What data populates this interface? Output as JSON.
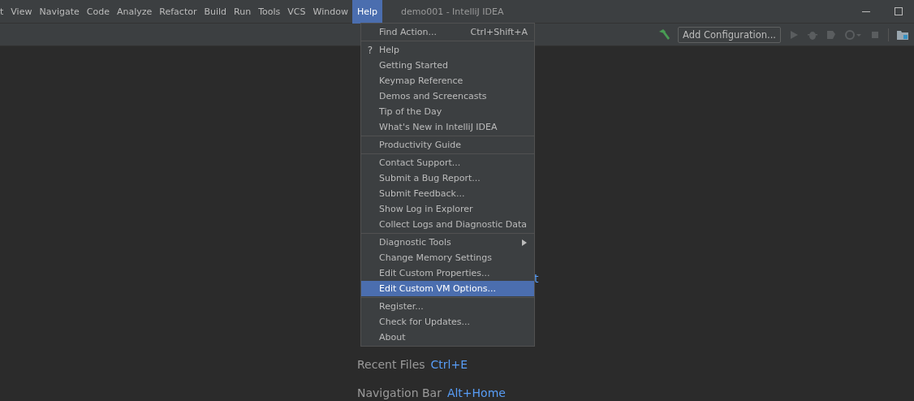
{
  "menu_bar": {
    "items": [
      {
        "label": "t",
        "selected": false
      },
      {
        "label": "View",
        "selected": false
      },
      {
        "label": "Navigate",
        "selected": false
      },
      {
        "label": "Code",
        "selected": false
      },
      {
        "label": "Analyze",
        "selected": false
      },
      {
        "label": "Refactor",
        "selected": false
      },
      {
        "label": "Build",
        "selected": false
      },
      {
        "label": "Run",
        "selected": false
      },
      {
        "label": "Tools",
        "selected": false
      },
      {
        "label": "VCS",
        "selected": false
      },
      {
        "label": "Window",
        "selected": false
      },
      {
        "label": "Help",
        "selected": true
      }
    ]
  },
  "window": {
    "title": "demo001 - IntelliJ IDEA"
  },
  "toolbar": {
    "run_config": "Add Configuration..."
  },
  "help_menu": {
    "groups": [
      [
        {
          "label": "Find Action...",
          "shortcut": "Ctrl+Shift+A",
          "selected": false
        }
      ],
      [
        {
          "glyph": "?",
          "label": "Help",
          "selected": false
        },
        {
          "label": "Getting Started",
          "selected": false
        },
        {
          "label": "Keymap Reference",
          "selected": false
        },
        {
          "label": "Demos and Screencasts",
          "selected": false
        },
        {
          "label": "Tip of the Day",
          "selected": false
        },
        {
          "label": "What's New in IntelliJ IDEA",
          "selected": false
        }
      ],
      [
        {
          "label": "Productivity Guide",
          "selected": false
        }
      ],
      [
        {
          "label": "Contact Support...",
          "selected": false
        },
        {
          "label": "Submit a Bug Report...",
          "selected": false
        },
        {
          "label": "Submit Feedback...",
          "selected": false
        },
        {
          "label": "Show Log in Explorer",
          "selected": false
        },
        {
          "label": "Collect Logs and Diagnostic Data",
          "selected": false
        }
      ],
      [
        {
          "label": "Diagnostic Tools",
          "submenu": true,
          "selected": false
        },
        {
          "label": "Change Memory Settings",
          "selected": false
        },
        {
          "label": "Edit Custom Properties...",
          "selected": false
        },
        {
          "label": "Edit Custom VM Options...",
          "selected": true
        }
      ],
      [
        {
          "label": "Register...",
          "selected": false
        },
        {
          "label": "Check for Updates...",
          "selected": false
        },
        {
          "label": "About",
          "selected": false
        }
      ]
    ]
  },
  "hints": [
    {
      "shortcut": "t"
    },
    {
      "label": "Recent Files",
      "shortcut": "Ctrl+E"
    },
    {
      "label": "Navigation Bar",
      "shortcut": "Alt+Home"
    }
  ]
}
